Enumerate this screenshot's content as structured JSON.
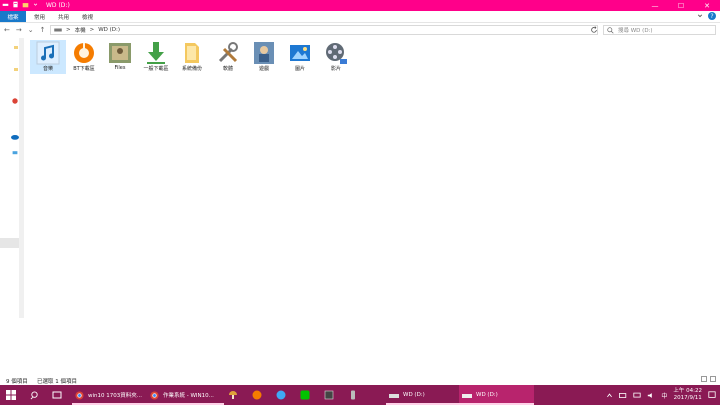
{
  "window": {
    "title": "WD (D:)",
    "controls": {
      "minimize": "—",
      "maximize": "☐",
      "close": "✕"
    }
  },
  "ribbon": {
    "tabs": [
      "檔案",
      "常用",
      "共用",
      "檢視"
    ]
  },
  "nav": {
    "back": "←",
    "forward": "→",
    "recent": "⌄",
    "up": "↑"
  },
  "address": {
    "sep": ">",
    "parts": [
      "本機",
      "WD (D:)"
    ]
  },
  "search": {
    "placeholder": "搜尋 WD (D:)"
  },
  "items": [
    {
      "label": "音樂",
      "icon": "itunes-music-icon"
    },
    {
      "label": "BT下載區",
      "icon": "orange-circle-icon"
    },
    {
      "label": "Files",
      "icon": "photo-folder-icon"
    },
    {
      "label": "一般下載區",
      "icon": "green-download-arrow-icon"
    },
    {
      "label": "系統備份",
      "icon": "folder-icon"
    },
    {
      "label": "軟體",
      "icon": "tools-icon"
    },
    {
      "label": "遊戲",
      "icon": "game-icon"
    },
    {
      "label": "圖片",
      "icon": "pictures-icon"
    },
    {
      "label": "影片",
      "icon": "film-reel-icon"
    }
  ],
  "status": {
    "count": "9 個項目",
    "selected": "已選取 1 個項目"
  },
  "taskbar": {
    "apps": [
      {
        "label": "win10 1703資料夾..."
      },
      {
        "label": "作業系統 - WIN10..."
      },
      {
        "label": "WD (D:)"
      },
      {
        "label": "WD (D:)"
      }
    ],
    "ime": "中",
    "time": "上午 04:22",
    "date": "2017/9/11"
  },
  "colors": {
    "accent": "#ff008a",
    "taskbar": "#8a1a54",
    "selection": "#cce8ff",
    "file_tab": "#1979ca"
  }
}
